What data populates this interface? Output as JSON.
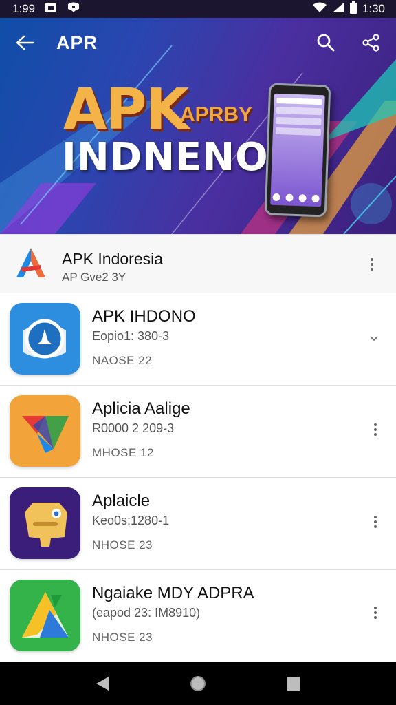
{
  "status_bar": {
    "time_left": "1:99",
    "time_right": "1:30"
  },
  "app_bar": {
    "title": "APR"
  },
  "banner": {
    "line1_big": "APK",
    "line1_small": "APRBY",
    "line2": "INDNENOIA"
  },
  "list_header": {
    "title": "APK Indoresia",
    "subtitle": "AP Gve2 3Y"
  },
  "apps": [
    {
      "name": "APK IHDONO",
      "meta": "Eopio1: 380-3",
      "size": "NAOSE 22",
      "icon": "blue-compass-icon"
    },
    {
      "name": "Aplicia Aalige",
      "meta": "R0000 2 209-3",
      "size": "MHOSE 12",
      "icon": "orange-colorful-v-icon"
    },
    {
      "name": "Aplaicle",
      "meta": "Keo0s:1280-1",
      "size": "NHOSE 23",
      "icon": "purple-robot-icon"
    },
    {
      "name": "Ngaiake MDY ADPRA",
      "meta": "(eapod 23: IM8910)",
      "size": "NHOSE 23",
      "icon": "green-triangle-icon"
    }
  ],
  "colors": {
    "status_bar": "#1c1530",
    "banner_start": "#0f4ea8",
    "banner_end": "#3a1f7a",
    "nav_bar": "#000000",
    "accent_orange": "#f4b347"
  }
}
